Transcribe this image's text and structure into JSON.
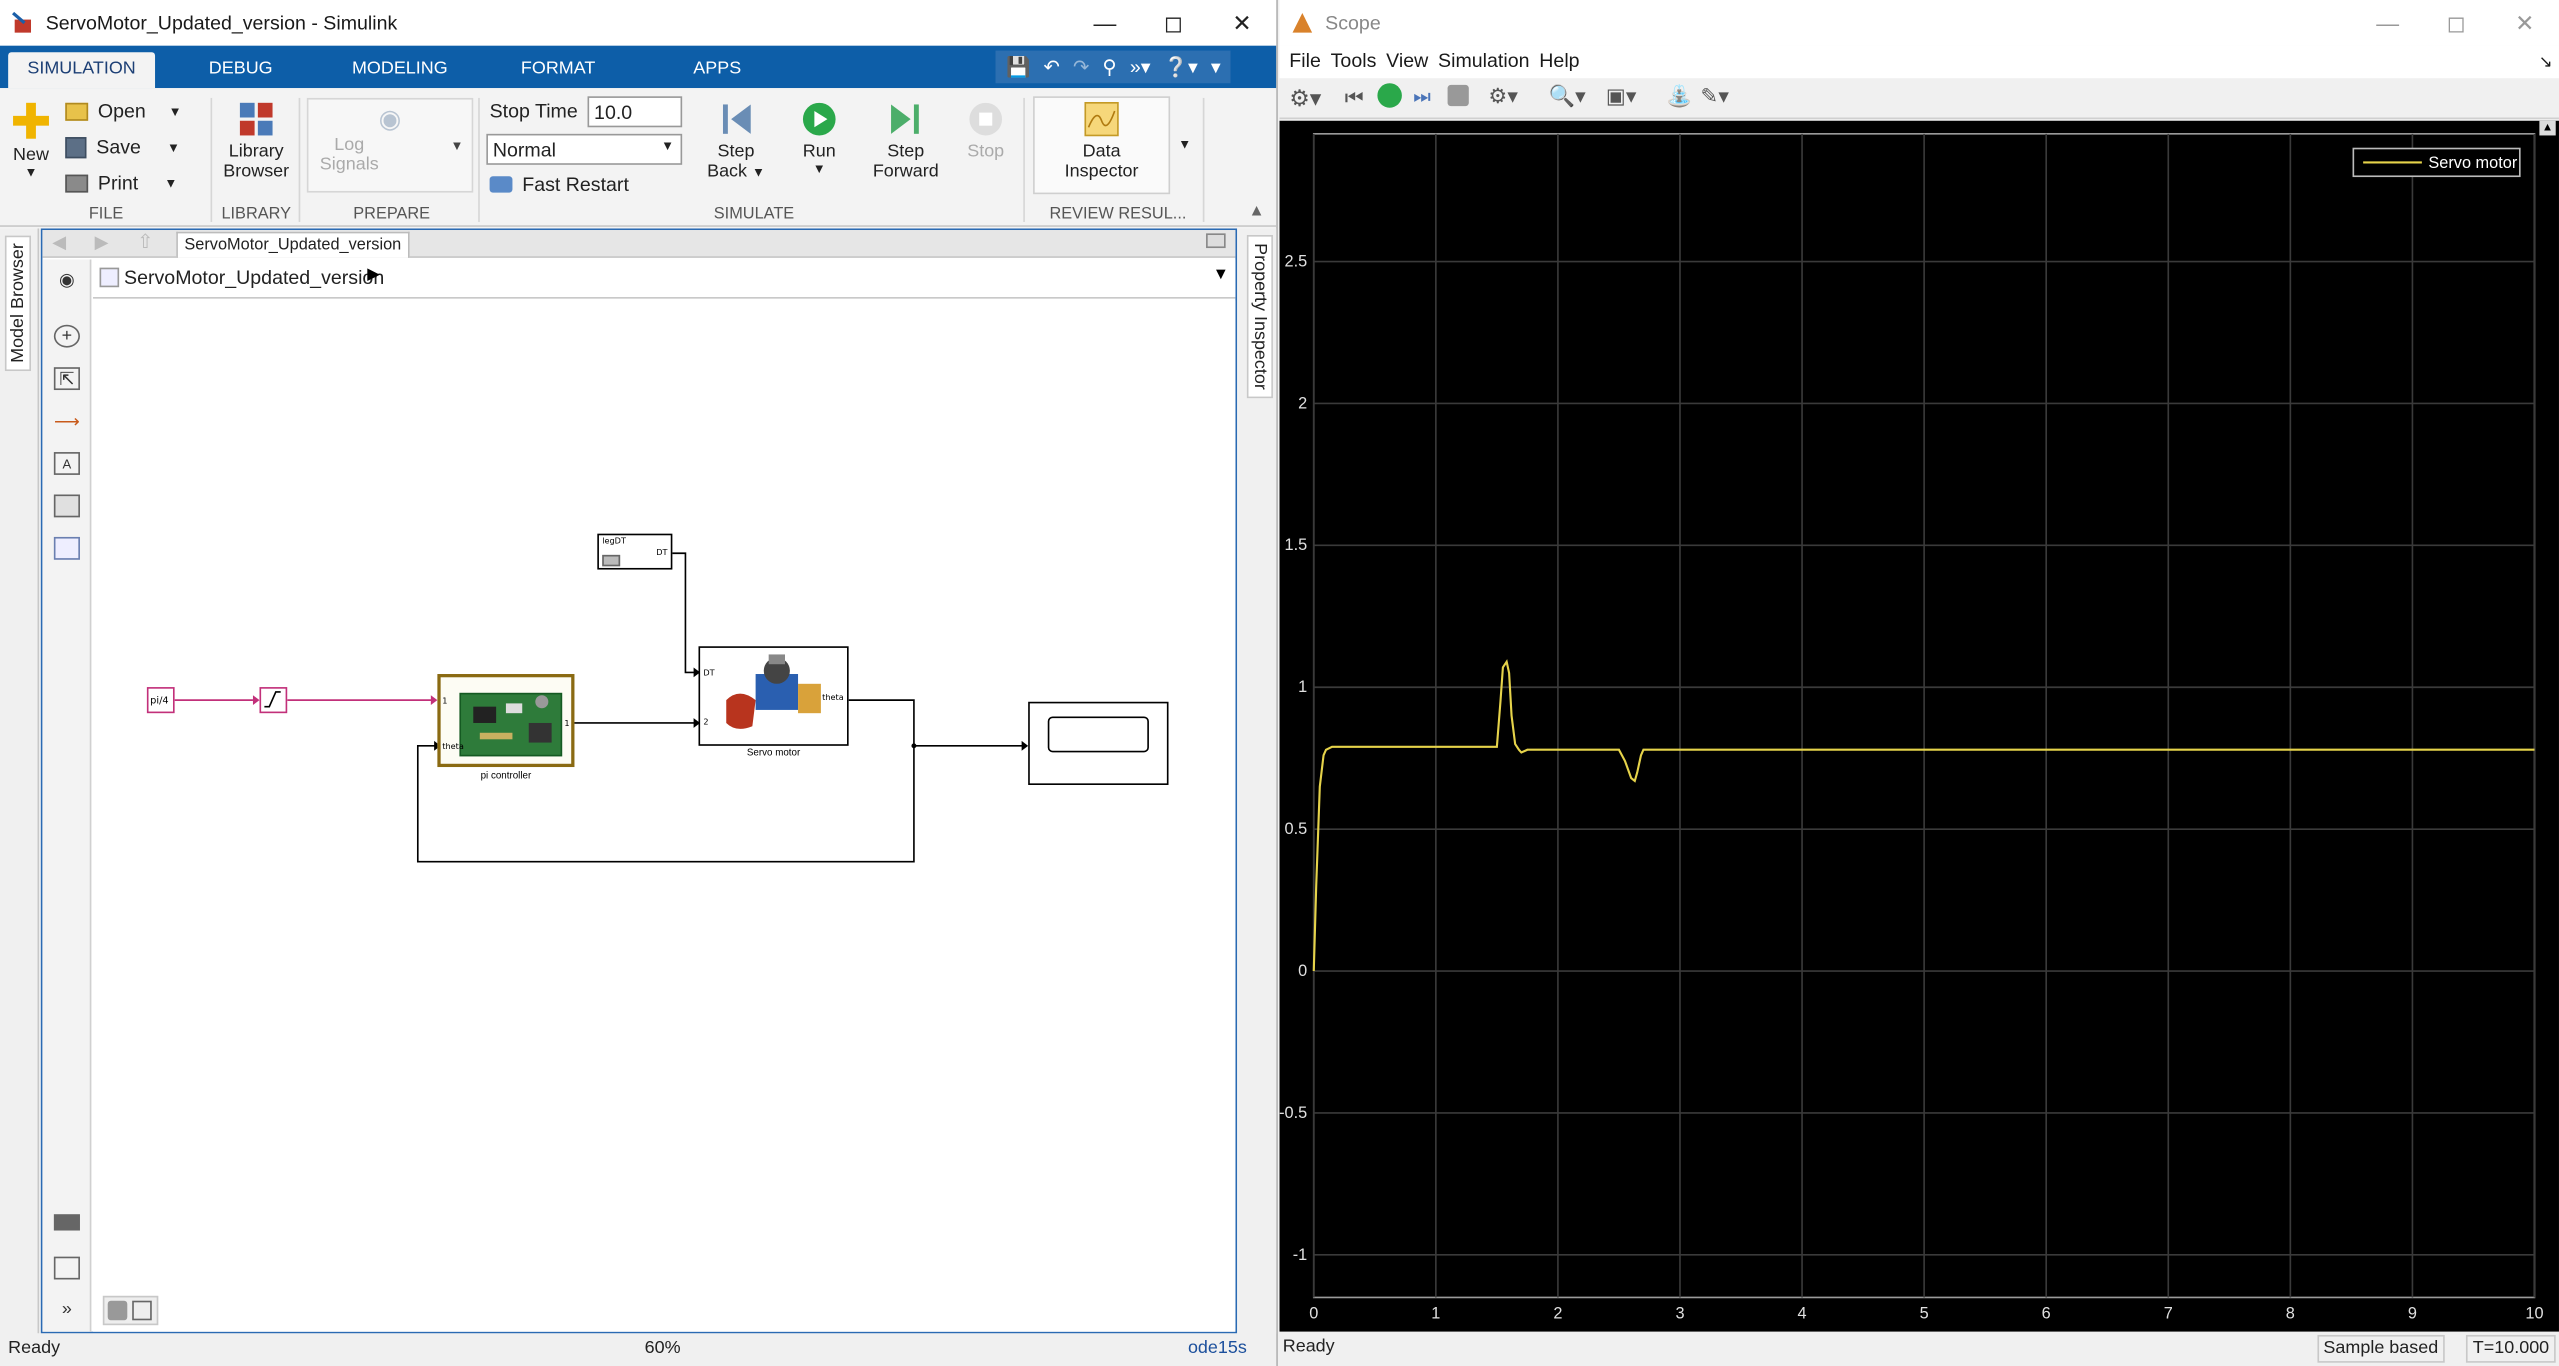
{
  "simulink": {
    "title": "ServoMotor_Updated_version - Simulink",
    "tabs": [
      "SIMULATION",
      "DEBUG",
      "MODELING",
      "FORMAT",
      "APPS"
    ],
    "ribbon": {
      "new": "New",
      "open": "Open",
      "save": "Save",
      "print": "Print",
      "library_browser": [
        "Library",
        "Browser"
      ],
      "log_signals": [
        "Log",
        "Signals"
      ],
      "stop_time_label": "Stop Time",
      "stop_time_value": "10.0",
      "mode": "Normal",
      "fast_restart": "Fast Restart",
      "step_back": [
        "Step",
        "Back"
      ],
      "run": "Run",
      "step_forward": [
        "Step",
        "Forward"
      ],
      "stop": "Stop",
      "data_inspector": [
        "Data",
        "Inspector"
      ],
      "sections": [
        "FILE",
        "LIBRARY",
        "PREPARE",
        "SIMULATE",
        "REVIEW RESUL..."
      ]
    },
    "left_panel": "Model Browser",
    "right_panel": "Property Inspector",
    "editor_tab": "ServoMotor_Updated_version",
    "breadcrumb": "ServoMotor_Updated_version",
    "model": {
      "constant_value": "pi/4",
      "legdt_label": "legDT",
      "legdt_port": "DT",
      "pi_in1": "1",
      "pi_in2": "theta",
      "pi_out": "1",
      "pi_label": "pi controller",
      "servo_dt": "DT",
      "servo_in": "2",
      "servo_out": "theta",
      "servo_label": "Servo motor"
    },
    "status": {
      "left": "Ready",
      "zoom": "60%",
      "solver": "ode15s"
    }
  },
  "scope": {
    "title": "Scope",
    "menu": [
      "File",
      "Tools",
      "View",
      "Simulation",
      "Help"
    ],
    "status": {
      "left": "Ready",
      "sample": "Sample based",
      "time": "T=10.000"
    },
    "colors": {
      "background": "#000000",
      "grid": "#3a3a3a",
      "trace": "#e6d34a"
    }
  },
  "chart_data": {
    "type": "line",
    "title": "",
    "xlabel": "",
    "ylabel": "",
    "xlim": [
      0,
      10
    ],
    "ylim": [
      -1.15,
      2.95
    ],
    "xticks": [
      0,
      1,
      2,
      3,
      4,
      5,
      6,
      7,
      8,
      9,
      10
    ],
    "yticks": [
      -1,
      -0.5,
      0,
      0.5,
      1,
      1.5,
      2,
      2.5
    ],
    "grid": true,
    "legend_position": "top-right",
    "series": [
      {
        "name": "Servo motor",
        "color": "#e6d34a",
        "x": [
          0,
          0.02,
          0.05,
          0.08,
          0.1,
          0.15,
          0.25,
          0.5,
          1.0,
          1.5,
          1.53,
          1.55,
          1.58,
          1.6,
          1.62,
          1.65,
          1.68,
          1.7,
          1.75,
          2.0,
          2.5,
          2.55,
          2.6,
          2.63,
          2.65,
          2.68,
          2.7,
          3.0,
          5.0,
          10.0
        ],
        "y": [
          0,
          0.3,
          0.65,
          0.76,
          0.78,
          0.79,
          0.79,
          0.79,
          0.79,
          0.79,
          0.95,
          1.07,
          1.09,
          1.05,
          0.9,
          0.8,
          0.78,
          0.77,
          0.78,
          0.78,
          0.78,
          0.74,
          0.68,
          0.67,
          0.7,
          0.76,
          0.78,
          0.78,
          0.78,
          0.78
        ]
      }
    ]
  }
}
